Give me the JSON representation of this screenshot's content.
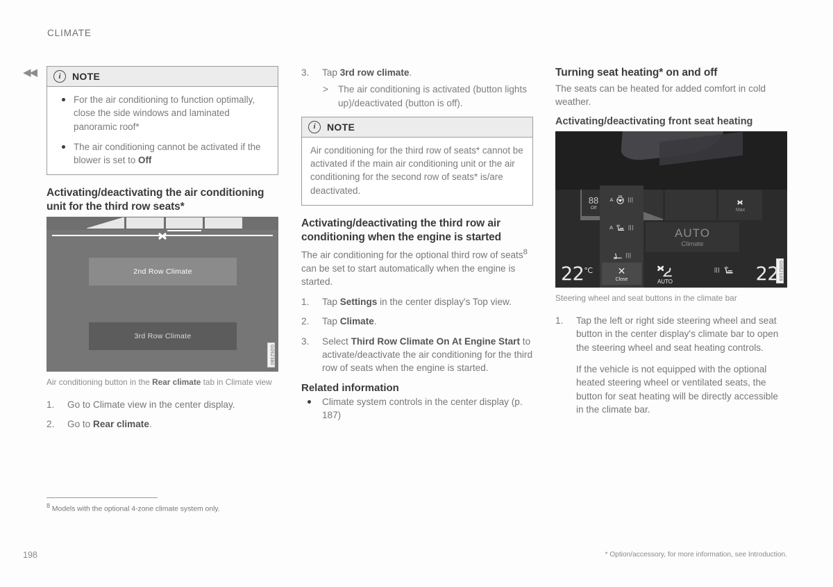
{
  "header": {
    "chapter": "CLIMATE",
    "back_icon": "double-chevron-left-icon"
  },
  "col1": {
    "note": {
      "icon": "info-icon",
      "title": "NOTE",
      "items": [
        "For the air conditioning to function optimally, close the side windows and laminated panoramic roof*",
        "The air conditioning cannot be activated if the blower is set to Off"
      ],
      "item2_prefix": "The air conditioning cannot be activated if the blower is set to ",
      "item2_bold": "Off"
    },
    "heading": "Activating/deactivating the air conditioning unit for the third row seats*",
    "figure": {
      "buttons": {
        "second_row": "2nd Row Climate",
        "third_row": "3rd Row Climate"
      },
      "fan_icon": "fan-icon",
      "code": "G052380"
    },
    "caption_pre": "Air conditioning button in the ",
    "caption_bold": "Rear climate",
    "caption_post": " tab in Climate view",
    "steps": [
      {
        "text": "Go to Climate view in the center display."
      },
      {
        "pre": "Go to ",
        "bold": "Rear climate",
        "post": "."
      }
    ]
  },
  "col2": {
    "step3": {
      "number": "3.",
      "pre": "Tap ",
      "bold": "3rd row climate",
      "post": ".",
      "substep": "The air conditioning is activated (button lights up)/deactivated (button is off)."
    },
    "note": {
      "icon": "info-icon",
      "title": "NOTE",
      "body": "Air conditioning for the third row of seats* cannot be activated if the main air conditioning unit or the air conditioning for the second row of seats* is/are deactivated."
    },
    "heading": "Activating/deactivating the third row air conditioning when the engine is started",
    "intro_a": "The air conditioning for the optional third row of seats",
    "intro_sup": "8",
    "intro_b": " can be set to start automatically when the engine is started.",
    "steps": [
      {
        "pre": "Tap ",
        "bold": "Settings",
        "post": " in the center display's Top view."
      },
      {
        "pre": "Tap ",
        "bold": "Climate",
        "post": "."
      },
      {
        "pre": "Select ",
        "bold": "Third Row Climate On At Engine Start",
        "post": " to activate/deactivate the air conditioning for the third row of seats when the engine is started."
      }
    ],
    "related_title": "Related information",
    "related_items": [
      "Climate system controls in the center display (p. 187)"
    ]
  },
  "col3": {
    "heading": "Turning seat heating* on and off",
    "intro": "The seats can be heated for added comfort in cold weather.",
    "subheading": "Activating/deactivating front seat heating",
    "figure": {
      "temp_left": "22",
      "temp_left_unit": "°C",
      "temp_right": "22",
      "auto_label": "AUTO",
      "auto_sub": "Climate",
      "fan_max_label": "Max",
      "fan_icon": "fan-icon",
      "auto_seat_label": "AUTO",
      "auto_seat_icon": "seat-ventilation-icon",
      "seat_heat_icon": "seat-heating-icon",
      "off_badge_symbol": "88",
      "off_badge_label": "Off",
      "popup": {
        "rows": [
          {
            "a": "A",
            "icon": "heated-steering-wheel-icon",
            "bars": "|||"
          },
          {
            "a": "A",
            "icon": "heated-seat-icon",
            "bars": "|||"
          },
          {
            "a": "",
            "icon": "ventilated-seat-icon",
            "bars": "|||"
          }
        ],
        "close_icon": "close-icon",
        "close_label": "Close"
      },
      "code": "G052108"
    },
    "caption": "Steering wheel and seat buttons in the climate bar",
    "steps": [
      {
        "text": "Tap the left or right side steering wheel and seat button in the center display's climate bar to open the steering wheel and seat heating controls.",
        "cont": "If the vehicle is not equipped with the optional heated steering wheel or ventilated seats, the button for seat heating will be directly accessible in the climate bar."
      }
    ]
  },
  "footnote": {
    "marker": "8",
    "text": " Models with the optional 4-zone climate system only."
  },
  "footer": {
    "page_number": "198",
    "option_note": "* Option/accessory, for more information, see Introduction."
  }
}
